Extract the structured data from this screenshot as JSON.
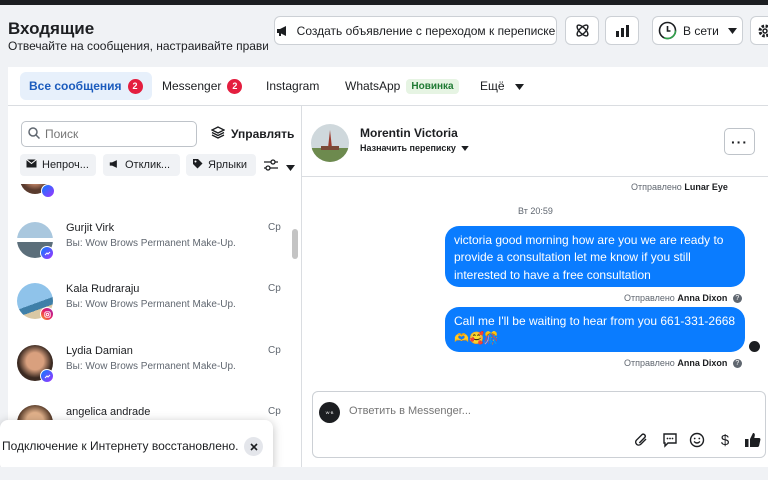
{
  "header": {
    "title": "Входящие",
    "subtitle": "Отвечайте на сообщения, настраивайте правил...",
    "create_ad_label": "Создать объявление с переходом к переписке",
    "status_label": "В сети",
    "icons": [
      "megaphone-icon",
      "integrations-icon",
      "insights-icon",
      "status-clock-icon",
      "settings-icon"
    ]
  },
  "tabs": [
    {
      "label": "Все сообщения",
      "badge": "2"
    },
    {
      "label": "Messenger",
      "badge": "2"
    },
    {
      "label": "Instagram"
    },
    {
      "label": "WhatsApp",
      "tag": "Новинка"
    },
    {
      "label": "Ещё"
    }
  ],
  "sidebar": {
    "search_placeholder": "Поиск",
    "manage_label": "Управлять",
    "filters": [
      "Непроч...",
      "Отклик...",
      "Ярлыки"
    ],
    "conversations": [
      {
        "name": "Gurjit Virk",
        "preview": "Вы: Wow Brows Permanent Make-Up...",
        "time": "Ср",
        "platform": "messenger"
      },
      {
        "name": "Kala Rudraraju",
        "preview": "Вы: Wow Brows Permanent Make-Up...",
        "time": "Ср",
        "platform": "instagram"
      },
      {
        "name": "Lydia Damian",
        "preview": "Вы: Wow Brows Permanent Make-Up...",
        "time": "Ср",
        "platform": "messenger"
      },
      {
        "name": "angelica andrade",
        "preview": "",
        "time": "Ср",
        "platform": "messenger"
      }
    ]
  },
  "toast": {
    "text": "Подключение к Интернету восстановлено."
  },
  "chat": {
    "contact_name": "Morentin Victoria",
    "assign_label": "Назначить переписку",
    "more_label": "···",
    "messages_meta": [
      {
        "prefix": "Отправлено",
        "author": "Lunar Eye"
      },
      {
        "prefix": "Отправлено",
        "author": "Anna Dixon"
      },
      {
        "prefix": "Отправлено",
        "author": "Anna Dixon"
      }
    ],
    "date_label": "Вт 20:59",
    "messages": [
      "victoria good morning how are you we are  ready to provide a consultation let me know  if you still interested to have  a free  consultation",
      "Call  me I'll be waiting to hear from you 661-331-2668 🫶🥰🎊"
    ],
    "compose_placeholder": "Ответить в Messenger...",
    "compose_avatar_text": "W·B",
    "compose_icons": [
      "attachment-icon",
      "saved-reply-icon",
      "emoji-icon",
      "payment-icon",
      "like-icon"
    ]
  },
  "colors": {
    "accent": "#0a7cff",
    "badge": "#e41e3f",
    "active_tab_bg": "#e7f0fb",
    "active_tab_text": "#1b5bbd"
  }
}
